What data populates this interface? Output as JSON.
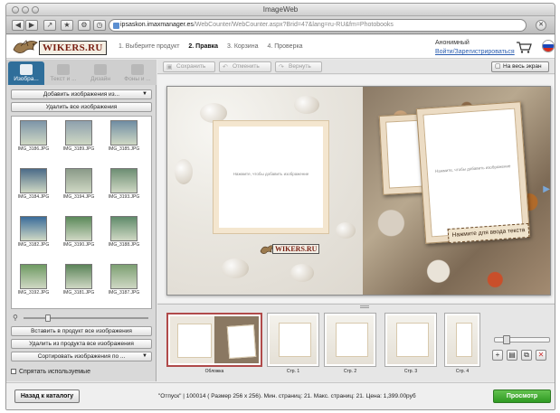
{
  "window": {
    "title": "ImageWeb"
  },
  "browser": {
    "url_host": "ipsaskon.imaxmanager.es",
    "url_path": "/WebCounter/WebCounter.aspx?Brid=47&lang=ru-RU&fm=Photobooks"
  },
  "header": {
    "logo_text": "WIKERS.RU",
    "steps": [
      "1. Выберите продукт",
      "2. Правка",
      "3. Корзина",
      "4. Проверка"
    ],
    "active_step": 1,
    "user_name": "Анонимный",
    "user_link": "Войти/Зарегистрироваться",
    "flag_colors": [
      "#ffffff",
      "#1c46b8",
      "#d52b1e"
    ]
  },
  "left_panel": {
    "tabs": [
      "Изобра...",
      "Текст и ...",
      "Дизайн",
      "Фоны и ..."
    ],
    "active_tab": 0,
    "add_images": "Добавить изображения из...",
    "delete_all": "Удалить все изображения",
    "images": [
      {
        "name": "IMG_3186.JPG",
        "color": "#7d95a8"
      },
      {
        "name": "IMG_3189.JPG",
        "color": "#8ea0ad"
      },
      {
        "name": "IMG_3185.JPG",
        "color": "#6f8da3"
      },
      {
        "name": "IMG_3184.JPG",
        "color": "#4b6b88"
      },
      {
        "name": "IMG_3194.JPG",
        "color": "#8a9a88"
      },
      {
        "name": "IMG_3193.JPG",
        "color": "#6d8e73"
      },
      {
        "name": "IMG_3182.JPG",
        "color": "#3a6c9a"
      },
      {
        "name": "IMG_3190.JPG",
        "color": "#5b8a5a"
      },
      {
        "name": "IMG_3188.JPG",
        "color": "#5f8b6a"
      },
      {
        "name": "IMG_3192.JPG",
        "color": "#6e9a62"
      },
      {
        "name": "IMG_3181.JPG",
        "color": "#5b8459"
      },
      {
        "name": "IMG_3187.JPG",
        "color": "#7c9f72"
      }
    ],
    "insert_images": "Вставить в продукт все изображения",
    "remove_from_product": "Удалить из продукта все изображения",
    "sort_images": "Сортировать изображения по ...",
    "hide_used": "Спрятать используемые"
  },
  "editor_toolbar": {
    "save": "Сохранить",
    "undo": "Отменить",
    "redo": "Вернуть",
    "fullscreen": "На весь экран"
  },
  "canvas": {
    "left_placeholder": "Нажмите, чтобы добавить изображение",
    "right_placeholder": "Нажмите, чтобы добавить изображение",
    "text_placeholder": "Нажмите для ввода текста",
    "watermark": "WIKERS.RU"
  },
  "pages": {
    "thumbs": [
      "Обложка",
      "Стр. 1",
      "Стр. 2",
      "Стр. 3",
      "Стр. 4"
    ],
    "selected": 0
  },
  "footer": {
    "back": "Назад к каталогу",
    "info": "\"Отпуск\" | 100014 ( Размер 256 x 256). Мин. страниц: 21. Макс. страниц: 21. Цена: 1,399.00руб",
    "preview": "Просмотр"
  },
  "colors": {
    "tab_active": "#2f6e9a",
    "preview_green": "#3aa02a",
    "link_blue": "#2a5db0"
  }
}
